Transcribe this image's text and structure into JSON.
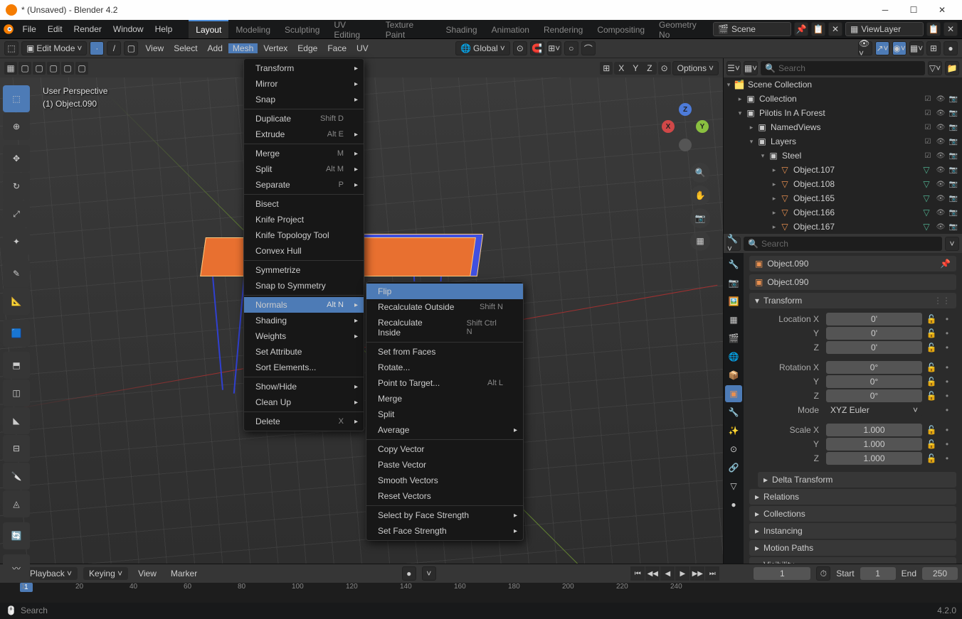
{
  "window": {
    "title": "* (Unsaved) - Blender 4.2"
  },
  "top_menu": [
    "File",
    "Edit",
    "Render",
    "Window",
    "Help"
  ],
  "workspaces": [
    "Layout",
    "Modeling",
    "Sculpting",
    "UV Editing",
    "Texture Paint",
    "Shading",
    "Animation",
    "Rendering",
    "Compositing",
    "Geometry No"
  ],
  "active_workspace": "Layout",
  "scene_name": "Scene",
  "view_layer": "ViewLayer",
  "editor": {
    "mode": "Edit Mode",
    "menus": [
      "View",
      "Select",
      "Add",
      "Mesh",
      "Vertex",
      "Edge",
      "Face",
      "UV"
    ],
    "orientation": "Global",
    "options": "Options"
  },
  "viewport": {
    "label1": "User Perspective",
    "label2": "(1) Object.090",
    "axes": [
      "X",
      "Y",
      "Z"
    ]
  },
  "mesh_menu": [
    {
      "label": "Transform",
      "sub": true
    },
    {
      "label": "Mirror",
      "sub": true
    },
    {
      "label": "Snap",
      "sub": true
    },
    {
      "sep": true
    },
    {
      "label": "Duplicate",
      "shortcut": "Shift D"
    },
    {
      "label": "Extrude",
      "shortcut": "Alt E",
      "sub": true
    },
    {
      "sep": true
    },
    {
      "label": "Merge",
      "shortcut": "M",
      "sub": true
    },
    {
      "label": "Split",
      "shortcut": "Alt M",
      "sub": true
    },
    {
      "label": "Separate",
      "shortcut": "P",
      "sub": true
    },
    {
      "sep": true
    },
    {
      "label": "Bisect"
    },
    {
      "label": "Knife Project"
    },
    {
      "label": "Knife Topology Tool"
    },
    {
      "label": "Convex Hull"
    },
    {
      "sep": true
    },
    {
      "label": "Symmetrize"
    },
    {
      "label": "Snap to Symmetry"
    },
    {
      "sep": true
    },
    {
      "label": "Normals",
      "shortcut": "Alt N",
      "sub": true,
      "hover": true
    },
    {
      "label": "Shading",
      "sub": true
    },
    {
      "label": "Weights",
      "sub": true
    },
    {
      "label": "Set Attribute"
    },
    {
      "label": "Sort Elements..."
    },
    {
      "sep": true
    },
    {
      "label": "Show/Hide",
      "sub": true
    },
    {
      "label": "Clean Up",
      "sub": true
    },
    {
      "sep": true
    },
    {
      "label": "Delete",
      "shortcut": "X",
      "sub": true
    }
  ],
  "normals_menu": [
    {
      "label": "Flip",
      "hover": true
    },
    {
      "label": "Recalculate Outside",
      "shortcut": "Shift N"
    },
    {
      "label": "Recalculate Inside",
      "shortcut": "Shift Ctrl N"
    },
    {
      "sep": true
    },
    {
      "label": "Set from Faces"
    },
    {
      "label": "Rotate..."
    },
    {
      "label": "Point to Target...",
      "shortcut": "Alt L"
    },
    {
      "label": "Merge"
    },
    {
      "label": "Split"
    },
    {
      "label": "Average",
      "sub": true
    },
    {
      "sep": true
    },
    {
      "label": "Copy Vector"
    },
    {
      "label": "Paste Vector"
    },
    {
      "label": "Smooth Vectors"
    },
    {
      "label": "Reset Vectors"
    },
    {
      "sep": true
    },
    {
      "label": "Select by Face Strength",
      "sub": true
    },
    {
      "label": "Set Face Strength",
      "sub": true
    }
  ],
  "outliner": {
    "search_placeholder": "Search",
    "root": "Scene Collection",
    "items": [
      {
        "indent": 1,
        "label": "Collection",
        "icon": "col"
      },
      {
        "indent": 1,
        "label": "Pilotis In A Forest",
        "icon": "col",
        "exp": true
      },
      {
        "indent": 2,
        "label": "NamedViews",
        "icon": "col"
      },
      {
        "indent": 2,
        "label": "Layers",
        "icon": "col",
        "exp": true
      },
      {
        "indent": 3,
        "label": "Steel",
        "icon": "col",
        "exp": true
      },
      {
        "indent": 4,
        "label": "Object.107",
        "icon": "obj"
      },
      {
        "indent": 4,
        "label": "Object.108",
        "icon": "obj"
      },
      {
        "indent": 4,
        "label": "Object.165",
        "icon": "obj"
      },
      {
        "indent": 4,
        "label": "Object.166",
        "icon": "obj"
      },
      {
        "indent": 4,
        "label": "Object.167",
        "icon": "obj"
      }
    ]
  },
  "props": {
    "search_placeholder": "Search",
    "object_name": "Object.090",
    "name_field": "Object.090",
    "transform": {
      "title": "Transform",
      "loc_x_label": "Location X",
      "loc_x": "0'",
      "loc_y": "0'",
      "loc_z": "0'",
      "rot_x_label": "Rotation X",
      "rot_x": "0°",
      "rot_y": "0°",
      "rot_z": "0°",
      "mode_label": "Mode",
      "mode": "XYZ Euler",
      "scale_x_label": "Scale X",
      "scale_x": "1.000",
      "scale_y": "1.000",
      "scale_z": "1.000",
      "y_label": "Y",
      "z_label": "Z"
    },
    "panels": [
      "Delta Transform",
      "Relations",
      "Collections",
      "Instancing",
      "Motion Paths",
      "Visibility"
    ]
  },
  "timeline": {
    "playback": "Playback",
    "keying": "Keying",
    "view": "View",
    "marker": "Marker",
    "current": "1",
    "start_label": "Start",
    "start": "1",
    "end_label": "End",
    "end": "250",
    "marks": [
      "1",
      "20",
      "40",
      "60",
      "80",
      "100",
      "120",
      "140",
      "160",
      "180",
      "200",
      "220",
      "240"
    ]
  },
  "status": {
    "search": "Search",
    "version": "4.2.0"
  }
}
